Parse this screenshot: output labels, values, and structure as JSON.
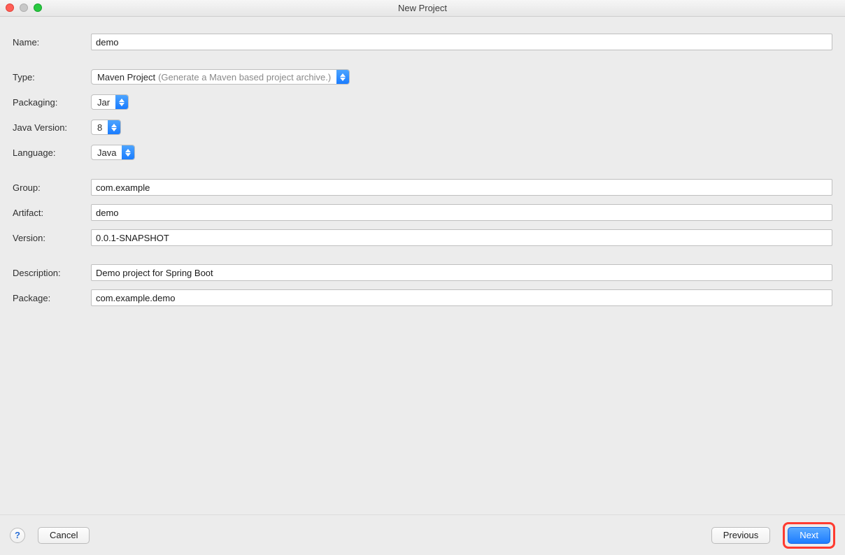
{
  "window": {
    "title": "New Project"
  },
  "form": {
    "name": {
      "label": "Name:",
      "value": "demo"
    },
    "type": {
      "label": "Type:",
      "value": "Maven Project",
      "hint": "(Generate a Maven based project archive.)"
    },
    "packaging": {
      "label": "Packaging:",
      "value": "Jar"
    },
    "javaVersion": {
      "label": "Java Version:",
      "value": "8"
    },
    "language": {
      "label": "Language:",
      "value": "Java"
    },
    "group": {
      "label": "Group:",
      "value": "com.example"
    },
    "artifact": {
      "label": "Artifact:",
      "value": "demo"
    },
    "version": {
      "label": "Version:",
      "value": "0.0.1-SNAPSHOT"
    },
    "description": {
      "label": "Description:",
      "value": "Demo project for Spring Boot"
    },
    "package": {
      "label": "Package:",
      "value": "com.example.demo"
    }
  },
  "footer": {
    "help": "?",
    "cancel": "Cancel",
    "previous": "Previous",
    "next": "Next"
  }
}
